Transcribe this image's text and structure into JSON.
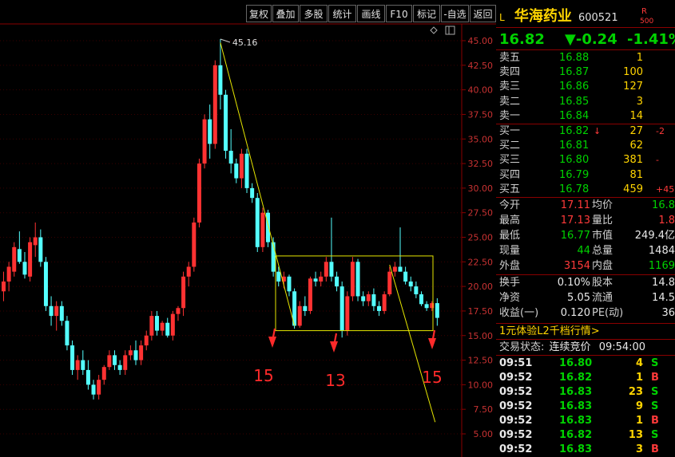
{
  "toolbar": [
    "复权",
    "叠加",
    "多股",
    "统计",
    "画线",
    "F10",
    "标记",
    "-自选",
    "返回"
  ],
  "chart_data": {
    "type": "candlestick",
    "y_ticks": [
      "45.00",
      "42.50",
      "40.00",
      "37.50",
      "35.00",
      "32.50",
      "30.00",
      "27.50",
      "25.00",
      "22.50",
      "20.00",
      "17.50",
      "15.00",
      "12.50",
      "10.00",
      "7.50",
      "5.00"
    ],
    "ylim": [
      5.0,
      45.0
    ],
    "max_label": "45.16",
    "annotations": [
      "15",
      "13",
      "15"
    ],
    "candles": [
      [
        19.5,
        21.5,
        18.5,
        20.5
      ],
      [
        20.5,
        22.5,
        19.5,
        22.0
      ],
      [
        21.5,
        24.5,
        21.0,
        24.0
      ],
      [
        23.8,
        25.6,
        22.3,
        22.5
      ],
      [
        22.5,
        23.5,
        20.8,
        21.2
      ],
      [
        21.0,
        25.0,
        20.5,
        24.5
      ],
      [
        24.2,
        26.5,
        23.0,
        25.0
      ],
      [
        25.0,
        25.8,
        22.0,
        22.5
      ],
      [
        22.5,
        23.0,
        17.5,
        18.0
      ],
      [
        18.0,
        19.0,
        16.0,
        17.0
      ],
      [
        17.0,
        18.5,
        15.5,
        18.0
      ],
      [
        18.0,
        18.5,
        16.0,
        16.5
      ],
      [
        16.5,
        17.0,
        13.5,
        14.0
      ],
      [
        14.0,
        14.5,
        11.0,
        11.5
      ],
      [
        11.5,
        13.0,
        10.5,
        12.5
      ],
      [
        12.5,
        13.5,
        11.0,
        11.5
      ],
      [
        11.5,
        12.5,
        9.5,
        10.0
      ],
      [
        10.0,
        10.5,
        8.5,
        9.0
      ],
      [
        9.0,
        11.0,
        8.5,
        10.5
      ],
      [
        10.5,
        12.0,
        10.0,
        11.8
      ],
      [
        11.8,
        13.5,
        11.5,
        13.0
      ],
      [
        13.0,
        13.5,
        11.5,
        12.0
      ],
      [
        12.0,
        12.5,
        11.0,
        11.5
      ],
      [
        11.5,
        13.5,
        11.0,
        13.0
      ],
      [
        13.0,
        14.0,
        12.5,
        13.5
      ],
      [
        13.5,
        14.5,
        12.0,
        12.5
      ],
      [
        12.5,
        14.5,
        12.0,
        14.0
      ],
      [
        14.0,
        15.5,
        13.5,
        15.0
      ],
      [
        15.0,
        17.5,
        14.5,
        17.0
      ],
      [
        17.0,
        17.5,
        15.0,
        15.5
      ],
      [
        15.5,
        16.5,
        15.0,
        16.3
      ],
      [
        16.3,
        16.8,
        14.8,
        15.0
      ],
      [
        15.0,
        17.5,
        14.5,
        17.2
      ],
      [
        17.2,
        18.0,
        16.5,
        17.8
      ],
      [
        17.8,
        21.5,
        17.0,
        21.0
      ],
      [
        21.0,
        22.5,
        20.0,
        22.0
      ],
      [
        22.0,
        27.0,
        21.5,
        26.5
      ],
      [
        26.5,
        33.0,
        26.0,
        32.5
      ],
      [
        32.5,
        37.5,
        32.0,
        37.0
      ],
      [
        37.0,
        38.5,
        33.0,
        34.5
      ],
      [
        34.5,
        43.0,
        34.0,
        42.5
      ],
      [
        42.5,
        45.16,
        38.0,
        39.5
      ],
      [
        39.5,
        40.0,
        33.0,
        33.8
      ],
      [
        33.8,
        36.0,
        31.5,
        32.5
      ],
      [
        32.5,
        33.0,
        30.5,
        31.0
      ],
      [
        31.0,
        34.0,
        30.0,
        33.5
      ],
      [
        33.5,
        34.0,
        29.5,
        30.0
      ],
      [
        30.0,
        30.5,
        28.5,
        29.0
      ],
      [
        29.0,
        29.5,
        23.5,
        24.0
      ],
      [
        24.0,
        28.0,
        23.5,
        27.5
      ],
      [
        27.5,
        27.8,
        24.0,
        24.5
      ],
      [
        24.5,
        25.0,
        21.0,
        21.5
      ],
      [
        21.5,
        22.0,
        20.0,
        20.5
      ],
      [
        20.5,
        21.5,
        19.8,
        21.0
      ],
      [
        21.0,
        21.2,
        19.0,
        19.5
      ],
      [
        19.5,
        19.8,
        15.7,
        16.0
      ],
      [
        16.0,
        18.5,
        15.8,
        18.0
      ],
      [
        18.0,
        19.0,
        17.0,
        17.5
      ],
      [
        17.5,
        21.0,
        17.2,
        20.8
      ],
      [
        20.8,
        21.5,
        20.0,
        20.5
      ],
      [
        20.5,
        21.5,
        20.0,
        21.0
      ],
      [
        21.0,
        23.0,
        20.5,
        22.5
      ],
      [
        22.5,
        27.0,
        20.5,
        21.0
      ],
      [
        21.0,
        21.5,
        19.5,
        20.0
      ],
      [
        20.0,
        20.5,
        14.8,
        15.5
      ],
      [
        15.5,
        19.5,
        15.0,
        19.0
      ],
      [
        19.0,
        23.0,
        18.5,
        22.5
      ],
      [
        22.5,
        22.8,
        18.5,
        19.0
      ],
      [
        19.0,
        19.5,
        18.0,
        18.5
      ],
      [
        18.5,
        19.5,
        18.0,
        19.2
      ],
      [
        19.2,
        19.8,
        17.5,
        18.0
      ],
      [
        18.0,
        18.5,
        17.0,
        17.5
      ],
      [
        17.5,
        19.5,
        17.2,
        19.2
      ],
      [
        19.2,
        22.0,
        19.0,
        21.5
      ],
      [
        21.5,
        22.5,
        21.0,
        22.0
      ],
      [
        22.0,
        26.0,
        21.5,
        21.5
      ],
      [
        21.5,
        22.0,
        20.2,
        20.5
      ],
      [
        20.5,
        21.0,
        19.5,
        20.0
      ],
      [
        20.0,
        20.5,
        18.8,
        19.2
      ],
      [
        19.2,
        19.5,
        18.0,
        18.2
      ],
      [
        18.2,
        18.5,
        17.5,
        17.8
      ],
      [
        17.8,
        18.5,
        17.5,
        18.3
      ],
      [
        18.3,
        18.8,
        16.0,
        16.8
      ]
    ]
  },
  "quote": {
    "flag": "L",
    "name": "华海药业",
    "code": "600521",
    "badge_top": "R",
    "badge_bottom": "500",
    "price": "16.82",
    "change": "▼-0.24",
    "pct": "-1.41%"
  },
  "sells": [
    {
      "label": "卖五",
      "price": "16.88",
      "vol": "1",
      "extra": ""
    },
    {
      "label": "卖四",
      "price": "16.87",
      "vol": "100",
      "extra": ""
    },
    {
      "label": "卖三",
      "price": "16.86",
      "vol": "127",
      "extra": ""
    },
    {
      "label": "卖二",
      "price": "16.85",
      "vol": "3",
      "extra": ""
    },
    {
      "label": "卖一",
      "price": "16.84",
      "vol": "14",
      "extra": ""
    }
  ],
  "buys": [
    {
      "label": "买一",
      "price": "16.82",
      "arrow": "↓",
      "vol": "27",
      "extra": "-2"
    },
    {
      "label": "买二",
      "price": "16.81",
      "arrow": "",
      "vol": "62",
      "extra": ""
    },
    {
      "label": "买三",
      "price": "16.80",
      "arrow": "",
      "vol": "381",
      "extra": "-"
    },
    {
      "label": "买四",
      "price": "16.79",
      "arrow": "",
      "vol": "81",
      "extra": ""
    },
    {
      "label": "买五",
      "price": "16.78",
      "arrow": "",
      "vol": "459",
      "extra": "+45"
    }
  ],
  "stats": [
    {
      "l1": "今开",
      "v1": "17.11",
      "c1": "red",
      "l2": "均价",
      "v2": "16.8",
      "c2": "grn"
    },
    {
      "l1": "最高",
      "v1": "17.13",
      "c1": "red",
      "l2": "量比",
      "v2": "1.8",
      "c2": "red"
    },
    {
      "l1": "最低",
      "v1": "16.77",
      "c1": "grn",
      "l2": "市值",
      "v2": "249.4亿",
      "c2": "wht"
    },
    {
      "l1": "现量",
      "v1": "44",
      "c1": "grn",
      "l2": "总量",
      "v2": "1484",
      "c2": "wht"
    },
    {
      "l1": "外盘",
      "v1": "3154",
      "c1": "red",
      "l2": "内盘",
      "v2": "1169",
      "c2": "grn"
    }
  ],
  "fund": [
    {
      "l1": "换手",
      "v1": "0.10%",
      "l2": "股本",
      "v2": "14.8"
    },
    {
      "l1": "净资",
      "v1": "5.05",
      "l2": "流通",
      "v2": "14.5"
    },
    {
      "l1": "收益(一)",
      "v1": "0.120",
      "l2": "PE(动)",
      "v2": "36"
    }
  ],
  "promo": "1元体验L2千档行情>",
  "status_label": "交易状态:",
  "status_value": "连续竞价",
  "status_time": "09:54:00",
  "trades": [
    {
      "t": "09:51",
      "p": "16.80",
      "v": "4",
      "s": "S"
    },
    {
      "t": "09:52",
      "p": "16.82",
      "v": "1",
      "s": "B"
    },
    {
      "t": "09:52",
      "p": "16.83",
      "v": "23",
      "s": "S"
    },
    {
      "t": "09:52",
      "p": "16.83",
      "v": "9",
      "s": "S"
    },
    {
      "t": "09:52",
      "p": "16.83",
      "v": "1",
      "s": "B"
    },
    {
      "t": "09:52",
      "p": "16.82",
      "v": "13",
      "s": "S"
    },
    {
      "t": "09:52",
      "p": "16.83",
      "v": "3",
      "s": "B"
    }
  ]
}
